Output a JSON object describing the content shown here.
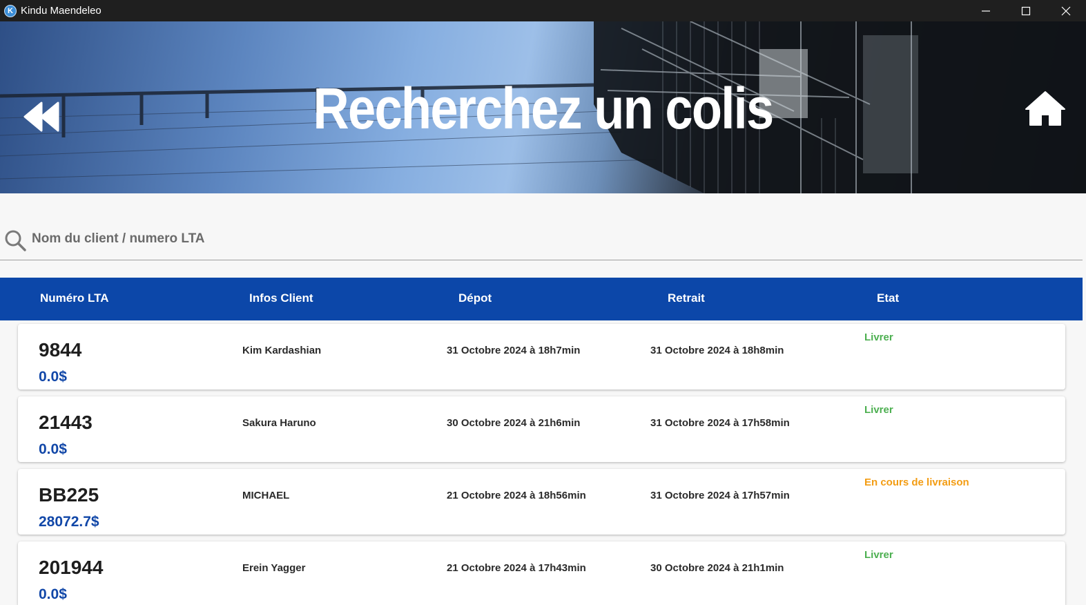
{
  "window": {
    "title": "Kindu Maendeleo",
    "icon": "app-logo-icon",
    "controls": [
      "minimize-icon",
      "maximize-icon",
      "close-icon"
    ]
  },
  "banner": {
    "title": "Recherchez un colis",
    "back_icon": "rewind-back-icon",
    "home_icon": "home-icon"
  },
  "search": {
    "placeholder": "Nom du client / numero LTA",
    "value": "",
    "icon": "search-icon"
  },
  "table": {
    "headers": {
      "lta": "Numéro LTA",
      "client": "Infos Client",
      "depot": "Dépot",
      "retrait": "Retrait",
      "etat": "Etat"
    },
    "rows": [
      {
        "lta": "9844",
        "price": "0.0$",
        "client": "Kim Kardashian",
        "depot": "31 Octobre 2024 à 18h7min",
        "retrait": "31 Octobre 2024 à 18h8min",
        "etat": "Livrer",
        "etat_color": "#4caf50"
      },
      {
        "lta": "21443",
        "price": "0.0$",
        "client": "Sakura Haruno",
        "depot": "30 Octobre 2024 à 21h6min",
        "retrait": "31 Octobre 2024 à 17h58min",
        "etat": "Livrer",
        "etat_color": "#4caf50"
      },
      {
        "lta": "BB225",
        "price": "28072.7$",
        "client": "MICHAEL",
        "depot": "21 Octobre 2024 à 18h56min",
        "retrait": "31 Octobre 2024 à 17h57min",
        "etat": "En cours de livraison",
        "etat_color": "#f39c12"
      },
      {
        "lta": "201944",
        "price": "0.0$",
        "client": "Erein Yagger",
        "depot": "21 Octobre 2024 à 17h43min",
        "retrait": "30 Octobre 2024 à 21h1min",
        "etat": "Livrer",
        "etat_color": "#4caf50"
      }
    ]
  },
  "colors": {
    "header_bg": "#0c47a9",
    "price": "#1147a8",
    "delivered": "#4caf50",
    "in_progress": "#f39c12"
  }
}
